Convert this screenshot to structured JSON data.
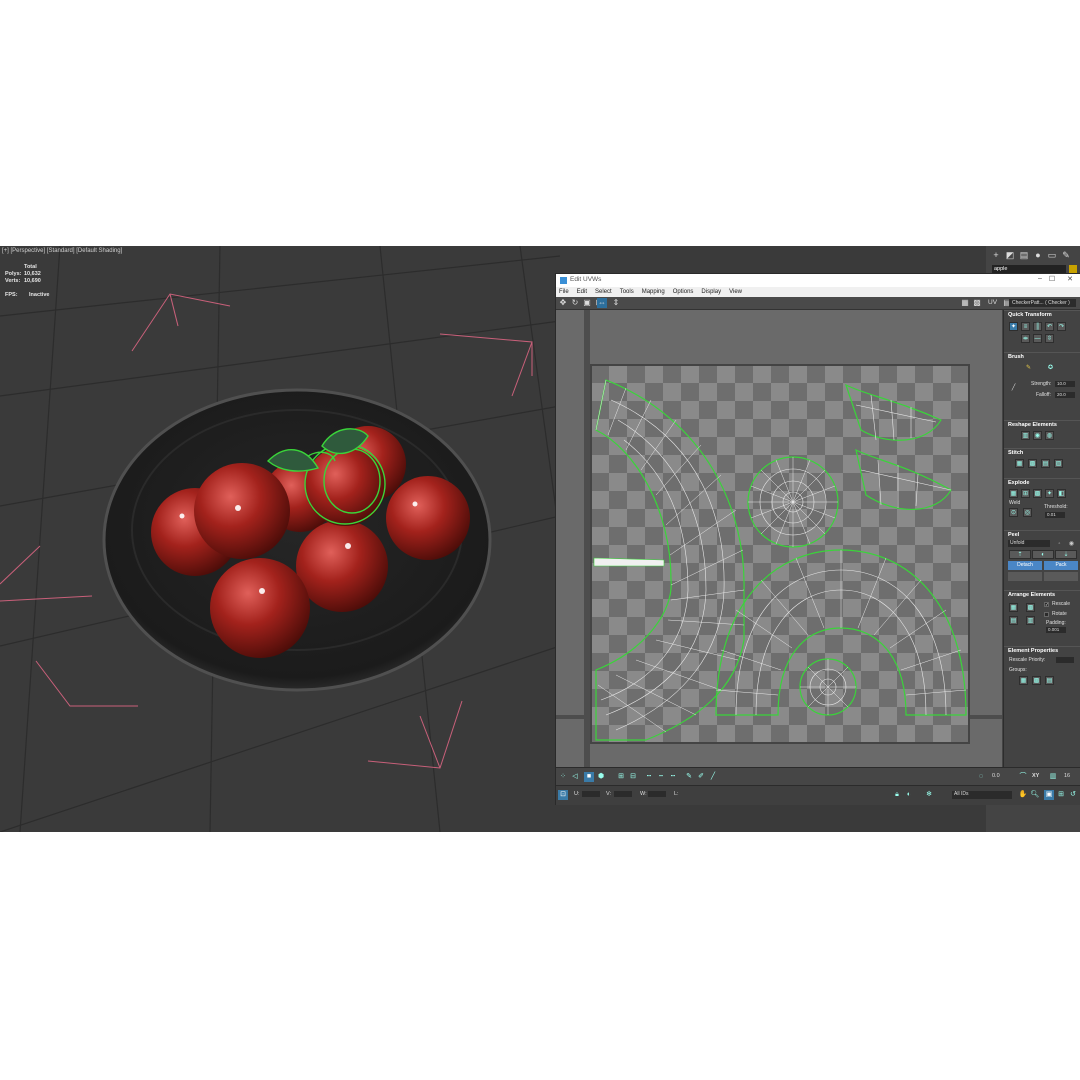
{
  "viewport": {
    "label": "[+] [Perspective] [Standard] [Default Shading]",
    "stats": {
      "total_label": "Total",
      "polys_label": "Polys:",
      "polys_value": "10,632",
      "verts_label": "Verts:",
      "verts_value": "10,690",
      "fps_label": "FPS:",
      "fps_value": "Inactive"
    }
  },
  "command_panel": {
    "object_name": "apple"
  },
  "uvw_window": {
    "title": "Edit UVWs",
    "menu": [
      "File",
      "Edit",
      "Select",
      "Tools",
      "Mapping",
      "Options",
      "Display",
      "View"
    ],
    "uv_label": "UV",
    "checker_pattern": "CheckerPatt... ( Checker )",
    "sections": {
      "quick_transform": "Quick Transform",
      "brush": "Brush",
      "strength_label": "Strength:",
      "strength_value": "10.0",
      "falloff_label": "Falloff:",
      "falloff_value": "20.0",
      "reshape": "Reshape Elements",
      "stitch": "Stitch",
      "explode": "Explode",
      "weld": "Weld",
      "threshold_label": "Threshold:",
      "threshold_value": "0.01",
      "peel": "Peel",
      "unfold": "Unfold",
      "detach": "Detach",
      "pack": "Pack",
      "arrange": "Arrange Elements",
      "rescale": "Rescale",
      "rotate": "Rotate",
      "padding_label": "Padding:",
      "padding_value": "0.001",
      "element_props": "Element Properties",
      "rescale_priority": "Rescale Priority:",
      "groups": "Groups:"
    },
    "bottom": {
      "u_label": "U:",
      "v_label": "V:",
      "w_label": "W:",
      "l_label": "L:",
      "ids": "All IDs",
      "zoom_value": "0.0",
      "xy_label": "XY",
      "grid_value": "16"
    }
  },
  "colors": {
    "viewport_bg": "#3a3a3a",
    "selection_green": "#3ad43a",
    "accent_blue": "#3a7ba8"
  }
}
